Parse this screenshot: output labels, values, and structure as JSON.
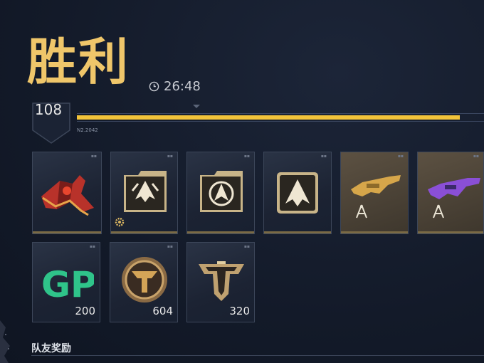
{
  "result": {
    "title": "胜利",
    "time": "26:48"
  },
  "level": {
    "value": "108",
    "xp_text": "N2.2042",
    "progress": 0.94
  },
  "rewards_row1": [
    {
      "name": "red-vehicle-skin",
      "qty": ""
    },
    {
      "name": "folder-emblem-1",
      "qty": ""
    },
    {
      "name": "folder-emblem-2",
      "qty": ""
    },
    {
      "name": "emblem-3",
      "qty": ""
    },
    {
      "name": "gold-rifle-blueprint",
      "qty": ""
    },
    {
      "name": "purple-rifle-blueprint",
      "qty": ""
    }
  ],
  "rewards_row2": [
    {
      "name": "gp-currency",
      "label": "GP",
      "qty": "200"
    },
    {
      "name": "bronze-token",
      "qty": "604"
    },
    {
      "name": "tier-badge",
      "qty": "320"
    }
  ],
  "section": {
    "teammate_rewards": "队友奖励"
  },
  "colors": {
    "accent": "#efc66a",
    "progress": "#f2c33a",
    "gp": "#2fc48a"
  }
}
